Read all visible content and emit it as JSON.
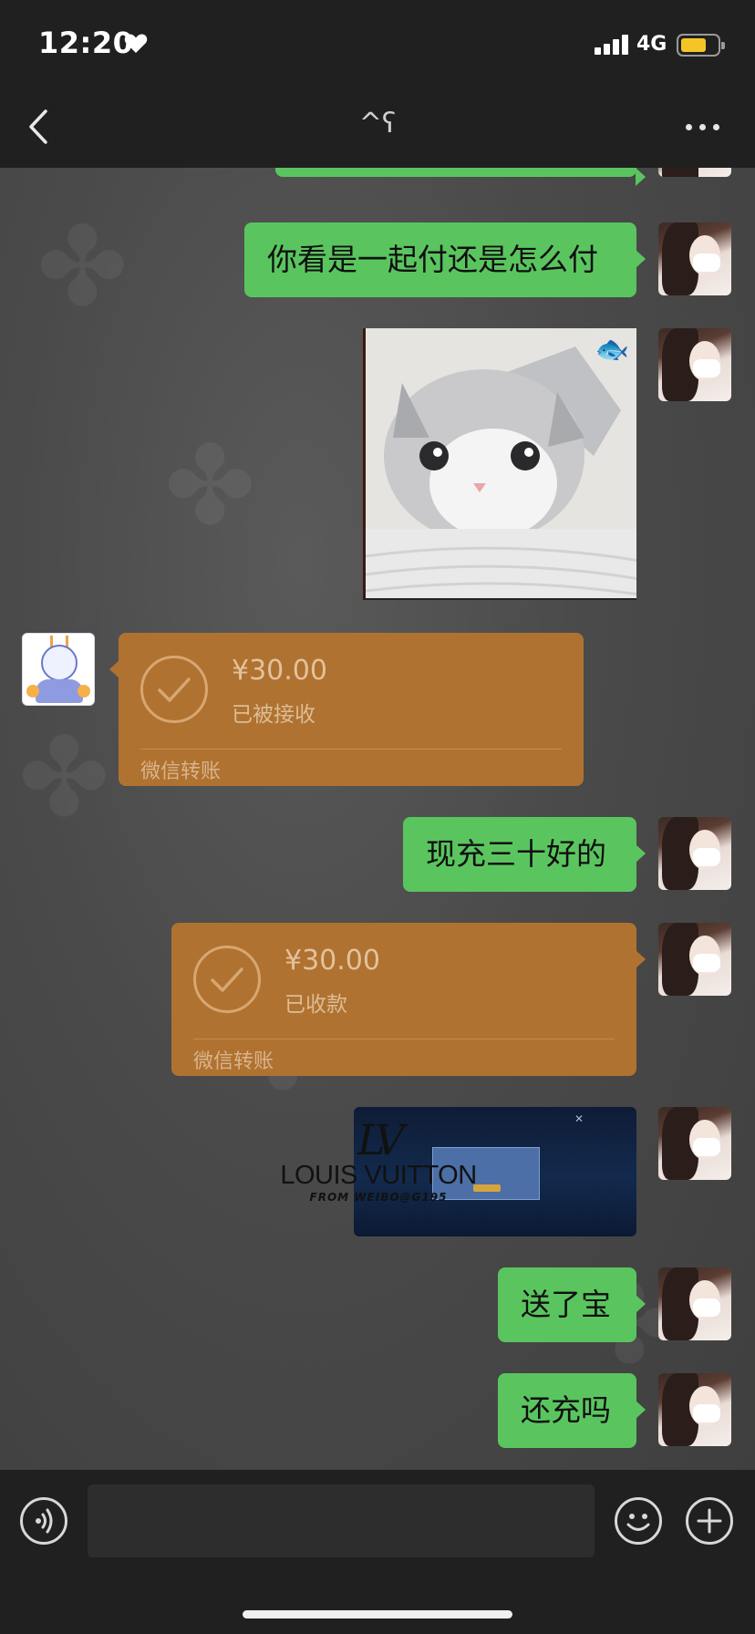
{
  "status_bar": {
    "time": "12:20",
    "network": "4G",
    "battery_level": 0.7,
    "icons": [
      "heart-icon",
      "signal-icon",
      "battery-icon"
    ]
  },
  "nav": {
    "title": "^ʕ",
    "back_icon": "chevron-left-icon",
    "more_icon": "more-dots-icon"
  },
  "messages": [
    {
      "side": "right",
      "type": "text",
      "text": "你看是一起付还是怎么付"
    },
    {
      "side": "right",
      "type": "image",
      "icon": "fish-icon"
    },
    {
      "side": "left",
      "type": "transfer",
      "amount": "¥30.00",
      "status": "已被接收",
      "label": "微信转账"
    },
    {
      "side": "right",
      "type": "text",
      "text": "现充三十好的"
    },
    {
      "side": "right",
      "type": "transfer",
      "amount": "¥30.00",
      "status": "已收款",
      "label": "微信转账"
    },
    {
      "side": "right",
      "type": "image"
    },
    {
      "side": "right",
      "type": "text",
      "text": "送了宝"
    },
    {
      "side": "right",
      "type": "text",
      "text": "还充吗"
    }
  ],
  "watermark": {
    "logo": "LV",
    "brand": "LOUIS VUITTON",
    "from": "FROM WEIBO@G195"
  },
  "input_bar": {
    "value": "",
    "placeholder": "",
    "icons": [
      "voice-icon",
      "emoji-icon",
      "plus-icon"
    ]
  },
  "colors": {
    "bubble_green": "#5ac55f",
    "transfer_orange": "#b07230",
    "bar_dark": "#202020"
  }
}
